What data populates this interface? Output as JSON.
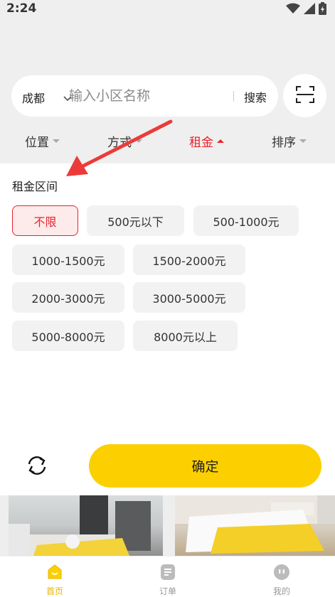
{
  "status_bar": {
    "time": "2:24"
  },
  "search": {
    "city": "成都",
    "placeholder": "输入小区名称",
    "button_label": "搜索"
  },
  "filter_tabs": [
    {
      "label": "位置",
      "active": false
    },
    {
      "label": "方式",
      "active": false
    },
    {
      "label": "租金",
      "active": true
    },
    {
      "label": "排序",
      "active": false
    }
  ],
  "rent_panel": {
    "title": "租金区间",
    "options": [
      {
        "label": "不限",
        "selected": true
      },
      {
        "label": "500元以下",
        "selected": false
      },
      {
        "label": "500-1000元",
        "selected": false
      },
      {
        "label": "1000-1500元",
        "selected": false
      },
      {
        "label": "1500-2000元",
        "selected": false
      },
      {
        "label": "2000-3000元",
        "selected": false
      },
      {
        "label": "3000-5000元",
        "selected": false
      },
      {
        "label": "5000-8000元",
        "selected": false
      },
      {
        "label": "8000元以上",
        "selected": false
      }
    ],
    "confirm_label": "确定"
  },
  "bottom_nav": [
    {
      "label": "首页",
      "icon": "home-icon",
      "active": true
    },
    {
      "label": "订单",
      "icon": "order-icon",
      "active": false
    },
    {
      "label": "我的",
      "icon": "profile-icon",
      "active": false
    }
  ],
  "colors": {
    "accent_red": "#e8232b",
    "confirm_yellow": "#fcd000",
    "nav_active": "#e8b400"
  }
}
